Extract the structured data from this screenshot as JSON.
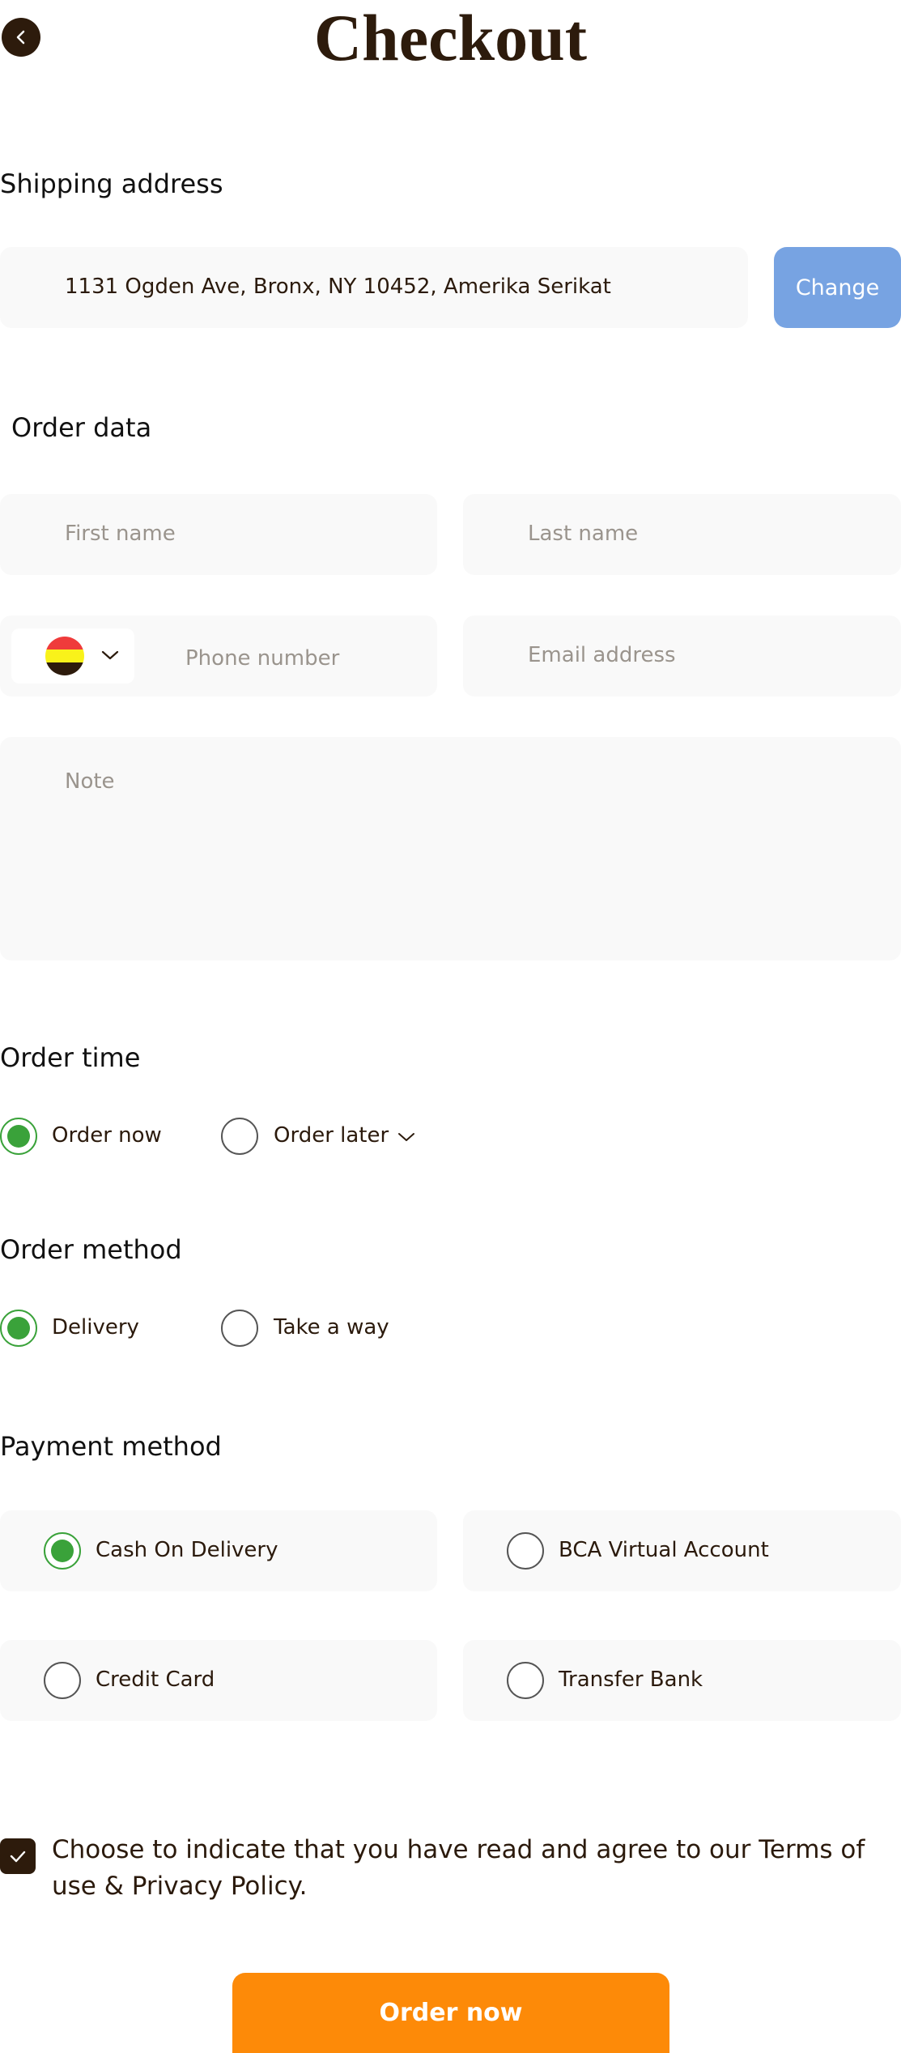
{
  "header": {
    "title": "Checkout",
    "back_icon": "chevron-left-icon"
  },
  "shipping": {
    "title": "Shipping address",
    "address": "1131 Ogden Ave, Bronx, NY 10452, Amerika Serikat",
    "change_label": "Change"
  },
  "order_data": {
    "title": "Order data",
    "first_name_placeholder": "First name",
    "last_name_placeholder": "Last name",
    "phone_placeholder": "Phone number",
    "email_placeholder": "Email address",
    "note_placeholder": "Note",
    "country_flag_icon": "flag-icon"
  },
  "order_time": {
    "title": "Order time",
    "options": [
      {
        "label": "Order now",
        "selected": true
      },
      {
        "label": "Order later",
        "selected": false
      }
    ]
  },
  "order_method": {
    "title": "Order method",
    "options": [
      {
        "label": "Delivery",
        "selected": true
      },
      {
        "label": "Take a way",
        "selected": false
      }
    ]
  },
  "payment": {
    "title": "Payment method",
    "options": [
      {
        "label": "Cash On Delivery",
        "selected": true
      },
      {
        "label": "BCA Virtual Account",
        "selected": false
      },
      {
        "label": "Credit Card",
        "selected": false
      },
      {
        "label": "Transfer Bank",
        "selected": false
      }
    ]
  },
  "terms": {
    "checked": true,
    "text": "Choose to indicate that you have read and agree to our Terms of use & Privacy Policy."
  },
  "submit": {
    "label": "Order now"
  },
  "colors": {
    "primary_dark": "#2d1b0c",
    "accent_orange": "#fd8a08",
    "change_blue": "#77a3e2",
    "radio_green": "#3aa23a",
    "field_bg": "#f9f9f9"
  }
}
